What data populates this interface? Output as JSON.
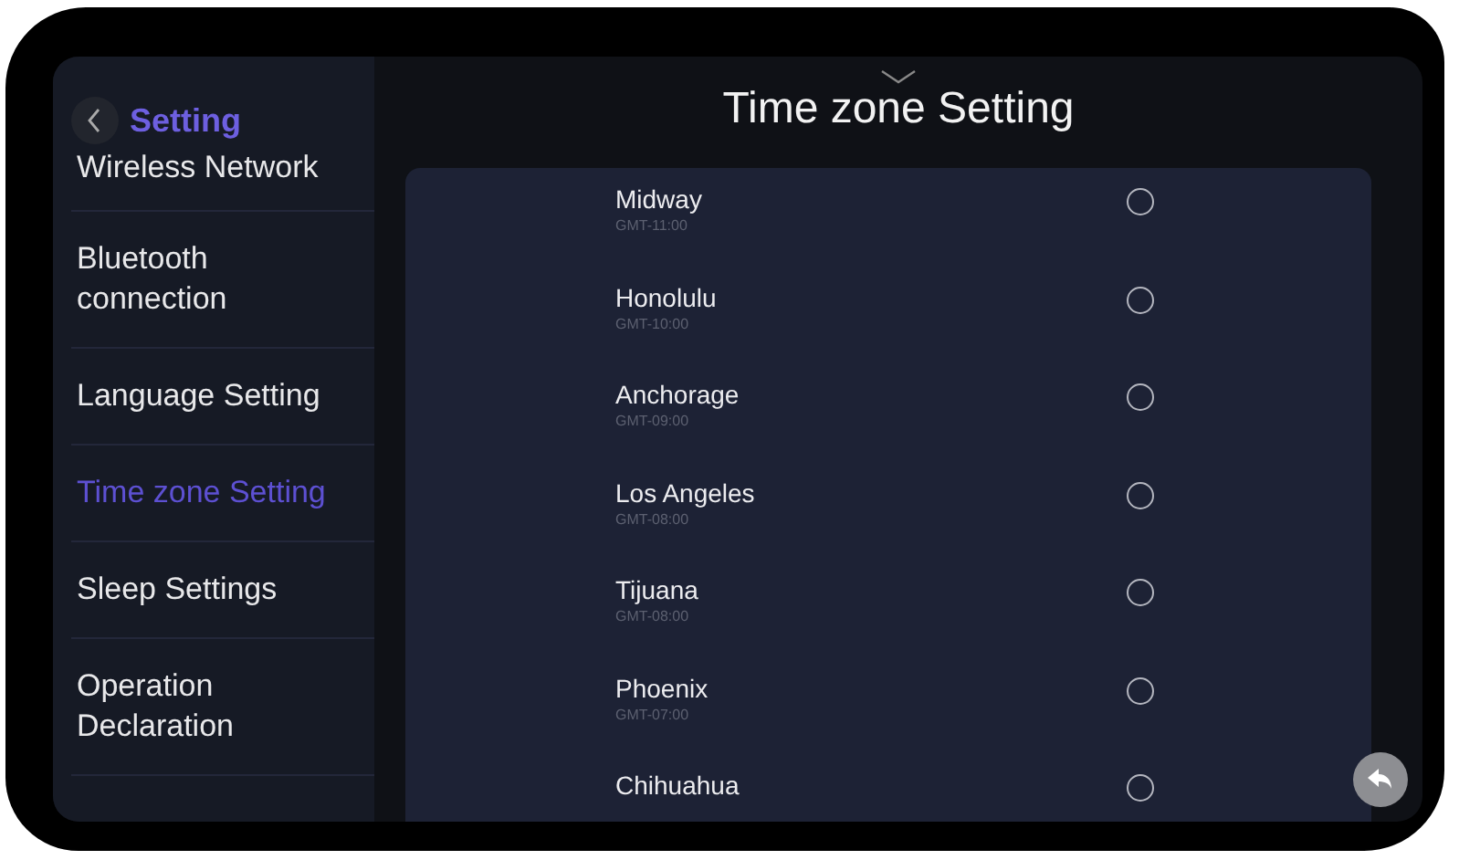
{
  "sidebar": {
    "title": "Setting",
    "items": [
      {
        "label": "Wireless Network",
        "selected": false
      },
      {
        "label": "Bluetooth connection",
        "selected": false
      },
      {
        "label": "Language Setting",
        "selected": false
      },
      {
        "label": "Time zone Setting",
        "selected": true
      },
      {
        "label": "Sleep Settings",
        "selected": false
      },
      {
        "label": "Operation Declaration",
        "selected": false
      }
    ]
  },
  "page_title": "Time zone Setting",
  "time_zones": [
    {
      "name": "Midway",
      "offset": "GMT-11:00",
      "selected": false
    },
    {
      "name": "Honolulu",
      "offset": "GMT-10:00",
      "selected": false
    },
    {
      "name": "Anchorage",
      "offset": "GMT-09:00",
      "selected": false
    },
    {
      "name": "Los Angeles",
      "offset": "GMT-08:00",
      "selected": false
    },
    {
      "name": "Tijuana",
      "offset": "GMT-08:00",
      "selected": false
    },
    {
      "name": "Phoenix",
      "offset": "GMT-07:00",
      "selected": false
    },
    {
      "name": "Chihuahua",
      "selected": false
    }
  ]
}
